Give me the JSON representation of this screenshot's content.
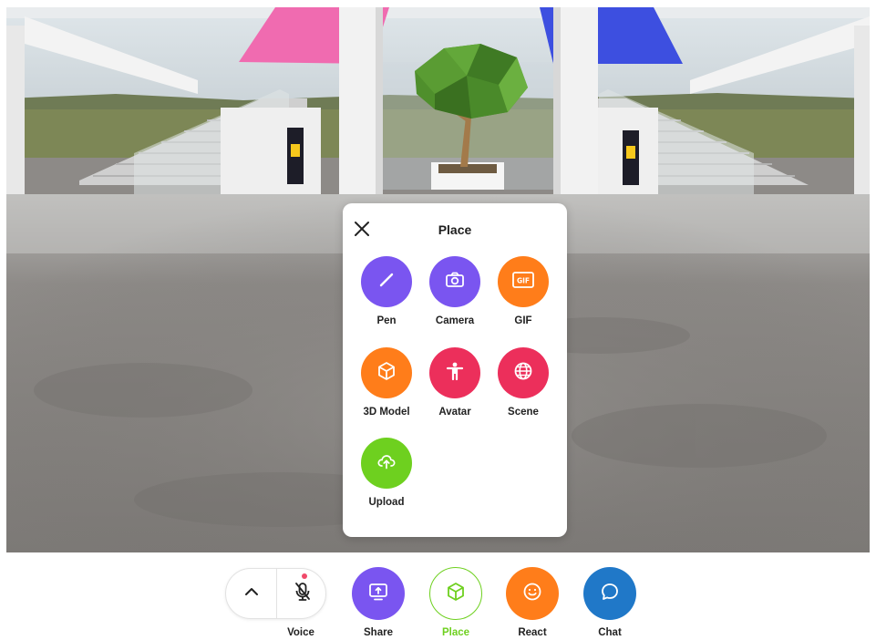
{
  "place_panel": {
    "title": "Place",
    "items": [
      {
        "label": "Pen",
        "icon": "pen-icon",
        "color": "#7a55f0"
      },
      {
        "label": "Camera",
        "icon": "camera-icon",
        "color": "#7a55f0"
      },
      {
        "label": "GIF",
        "icon": "gif-icon",
        "color": "#ff7d1a",
        "icon_text": "GIF"
      },
      {
        "label": "3D Model",
        "icon": "cube-icon",
        "color": "#ff7d1a"
      },
      {
        "label": "Avatar",
        "icon": "avatar-icon",
        "color": "#ec2f5b"
      },
      {
        "label": "Scene",
        "icon": "globe-icon",
        "color": "#ec2f5b"
      },
      {
        "label": "Upload",
        "icon": "cloud-upload-icon",
        "color": "#6ed01f"
      }
    ]
  },
  "toolbar": {
    "voice_label": "Voice",
    "share_label": "Share",
    "place_label": "Place",
    "react_label": "React",
    "chat_label": "Chat",
    "colors": {
      "share": "#7a55f0",
      "place": "#6ed01f",
      "react": "#ff7d1a",
      "chat": "#2078c8",
      "mic_dot": "#f04a6a"
    }
  }
}
